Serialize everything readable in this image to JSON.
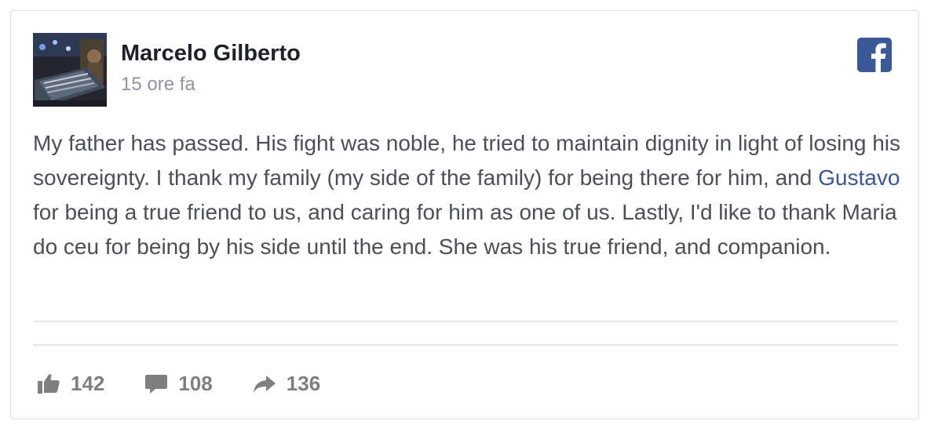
{
  "post": {
    "author_name": "Marcelo Gilberto",
    "timestamp": "15 ore fa",
    "message": {
      "part1": "My father has passed. His fight was noble, he tried to maintain dignity in light of losing his sovereignty. I thank my family (my side of the family) for being there for him, and ",
      "mention": "Gustavo",
      "part2": " for being a true friend to us, and caring for him as one of us. Lastly, I'd like to thank Maria do ceu for being by his side until the end. She was his true friend, and companion."
    }
  },
  "actions": {
    "likes": "142",
    "comments": "108",
    "shares": "136"
  },
  "icons": {
    "brand": "facebook-logo-icon",
    "like": "thumbs-up-icon",
    "comment": "speech-bubble-icon",
    "share": "share-arrow-icon"
  },
  "colors": {
    "facebook_blue": "#3b5998",
    "mention_link": "#365899",
    "body_text": "#4b4f56",
    "meta_text": "#90949c",
    "action_gray": "#7f7f7f"
  }
}
